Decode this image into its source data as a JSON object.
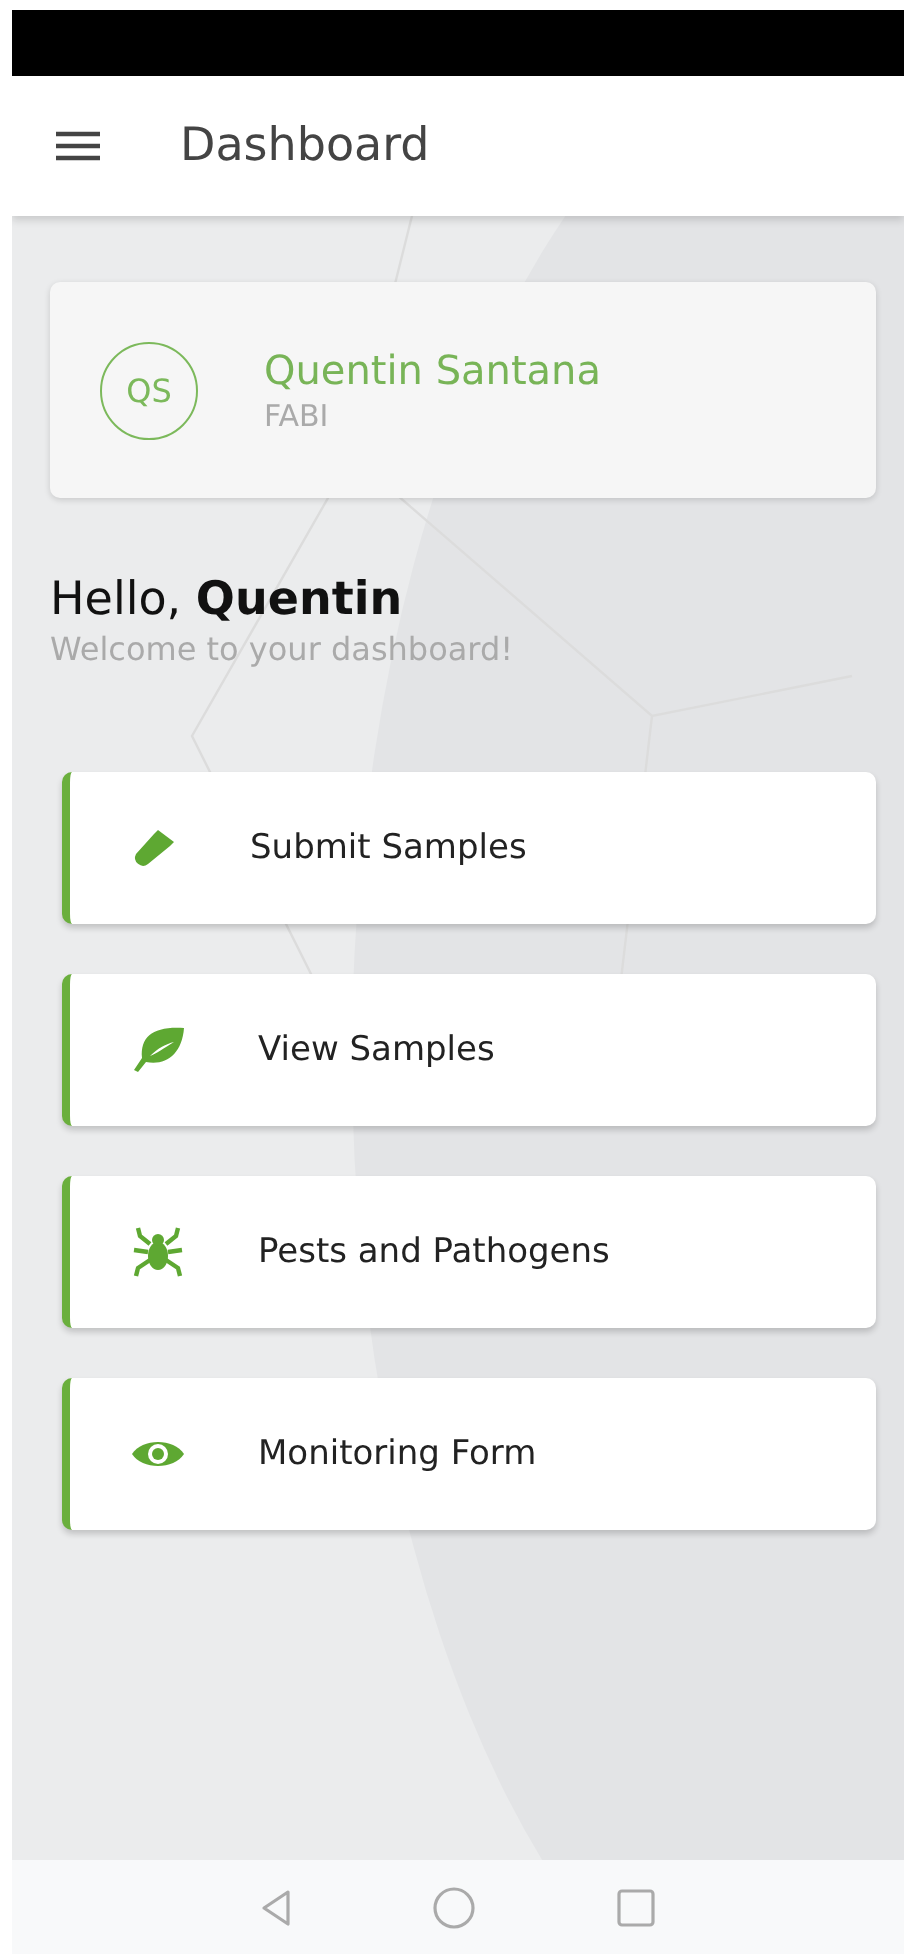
{
  "header": {
    "title": "Dashboard"
  },
  "profile": {
    "initials": "QS",
    "name": "Quentin Santana",
    "organization": "FABI"
  },
  "greeting": {
    "title": "Hello, **Quentin**",
    "subtitle": "Welcome to your dashboard!"
  },
  "menu": [
    {
      "kind": "tube",
      "label": "Submit Samples"
    },
    {
      "kind": "leaf",
      "label": "View Samples"
    },
    {
      "kind": "bug",
      "label": "Pests and Pathogens"
    },
    {
      "kind": "eye",
      "label": "Monitoring Form"
    }
  ]
}
